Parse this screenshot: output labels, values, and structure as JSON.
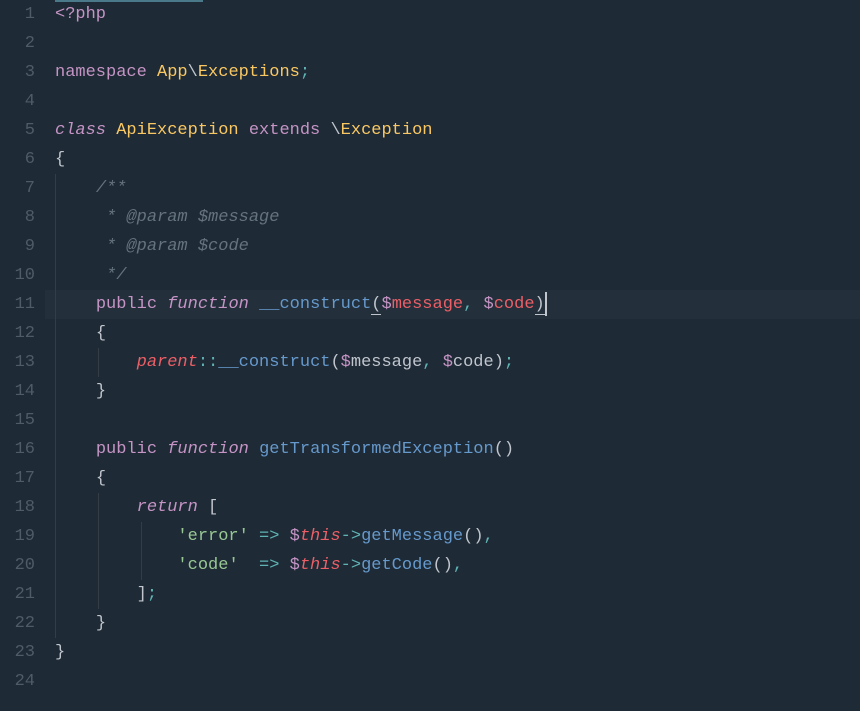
{
  "line_numbers": [
    "1",
    "2",
    "3",
    "4",
    "5",
    "6",
    "7",
    "8",
    "9",
    "10",
    "11",
    "12",
    "13",
    "14",
    "15",
    "16",
    "17",
    "18",
    "19",
    "20",
    "21",
    "22",
    "23",
    "24"
  ],
  "highlighted_line": 11,
  "tokens": {
    "l1": {
      "php_open": "<?php"
    },
    "l3": {
      "ns_kw": "namespace",
      "ns1": "App",
      "sep": "\\",
      "ns2": "Exceptions",
      "semi": ";"
    },
    "l5": {
      "class_kw": "class",
      "cls": "ApiException",
      "ext_kw": "extends",
      "sep": "\\",
      "parent": "Exception"
    },
    "l6": {
      "brace": "{"
    },
    "l7": {
      "c": "/**"
    },
    "l8": {
      "star": " *",
      "tag": "@param",
      "var": "$message"
    },
    "l9": {
      "star": " *",
      "tag": "@param",
      "var": "$code"
    },
    "l10": {
      "c": " */"
    },
    "l11": {
      "pub": "public",
      "fn": "function",
      "name": "__construct",
      "lp": "(",
      "d1": "$",
      "v1": "message",
      "c1": ",",
      "d2": "$",
      "v2": "code",
      "rp": ")"
    },
    "l12": {
      "brace": "{"
    },
    "l13": {
      "parent": "parent",
      "dc": "::",
      "name": "__construct",
      "lp": "(",
      "d1": "$",
      "v1": "message",
      "c1": ",",
      "d2": "$",
      "v2": "code",
      "rp": ")",
      "semi": ";"
    },
    "l14": {
      "brace": "}"
    },
    "l16": {
      "pub": "public",
      "fn": "function",
      "name": "getTransformedException",
      "lp": "(",
      "rp": ")"
    },
    "l17": {
      "brace": "{"
    },
    "l18": {
      "ret": "return",
      "br": "["
    },
    "l19": {
      "q1": "'",
      "s": "error",
      "q2": "'",
      "arr": "=>",
      "d": "$",
      "this": "this",
      "obj": "->",
      "m": "getMessage",
      "lp": "(",
      "rp": ")",
      "c": ","
    },
    "l20": {
      "q1": "'",
      "s": "code",
      "q2": "'",
      "arr": "=>",
      "d": "$",
      "this": "this",
      "obj": "->",
      "m": "getCode",
      "lp": "(",
      "rp": ")",
      "c": ","
    },
    "l21": {
      "br": "]",
      "semi": ";"
    },
    "l22": {
      "brace": "}"
    },
    "l23": {
      "brace": "}"
    }
  }
}
